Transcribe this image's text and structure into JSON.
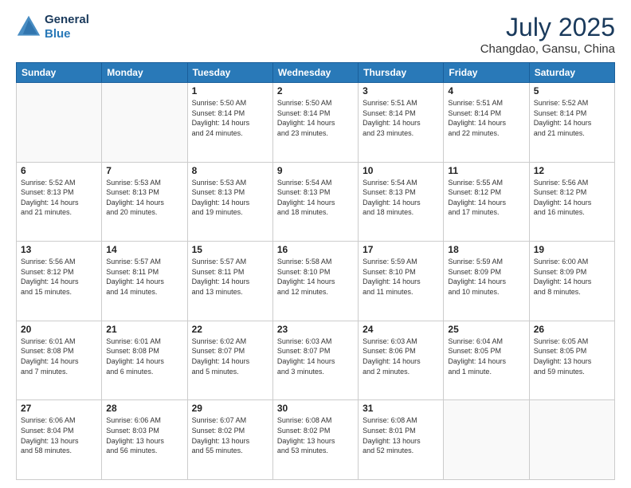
{
  "header": {
    "logo_line1": "General",
    "logo_line2": "Blue",
    "title": "July 2025",
    "subtitle": "Changdao, Gansu, China"
  },
  "weekdays": [
    "Sunday",
    "Monday",
    "Tuesday",
    "Wednesday",
    "Thursday",
    "Friday",
    "Saturday"
  ],
  "weeks": [
    [
      {
        "day": "",
        "info": ""
      },
      {
        "day": "",
        "info": ""
      },
      {
        "day": "1",
        "info": "Sunrise: 5:50 AM\nSunset: 8:14 PM\nDaylight: 14 hours\nand 24 minutes."
      },
      {
        "day": "2",
        "info": "Sunrise: 5:50 AM\nSunset: 8:14 PM\nDaylight: 14 hours\nand 23 minutes."
      },
      {
        "day": "3",
        "info": "Sunrise: 5:51 AM\nSunset: 8:14 PM\nDaylight: 14 hours\nand 23 minutes."
      },
      {
        "day": "4",
        "info": "Sunrise: 5:51 AM\nSunset: 8:14 PM\nDaylight: 14 hours\nand 22 minutes."
      },
      {
        "day": "5",
        "info": "Sunrise: 5:52 AM\nSunset: 8:14 PM\nDaylight: 14 hours\nand 21 minutes."
      }
    ],
    [
      {
        "day": "6",
        "info": "Sunrise: 5:52 AM\nSunset: 8:13 PM\nDaylight: 14 hours\nand 21 minutes."
      },
      {
        "day": "7",
        "info": "Sunrise: 5:53 AM\nSunset: 8:13 PM\nDaylight: 14 hours\nand 20 minutes."
      },
      {
        "day": "8",
        "info": "Sunrise: 5:53 AM\nSunset: 8:13 PM\nDaylight: 14 hours\nand 19 minutes."
      },
      {
        "day": "9",
        "info": "Sunrise: 5:54 AM\nSunset: 8:13 PM\nDaylight: 14 hours\nand 18 minutes."
      },
      {
        "day": "10",
        "info": "Sunrise: 5:54 AM\nSunset: 8:13 PM\nDaylight: 14 hours\nand 18 minutes."
      },
      {
        "day": "11",
        "info": "Sunrise: 5:55 AM\nSunset: 8:12 PM\nDaylight: 14 hours\nand 17 minutes."
      },
      {
        "day": "12",
        "info": "Sunrise: 5:56 AM\nSunset: 8:12 PM\nDaylight: 14 hours\nand 16 minutes."
      }
    ],
    [
      {
        "day": "13",
        "info": "Sunrise: 5:56 AM\nSunset: 8:12 PM\nDaylight: 14 hours\nand 15 minutes."
      },
      {
        "day": "14",
        "info": "Sunrise: 5:57 AM\nSunset: 8:11 PM\nDaylight: 14 hours\nand 14 minutes."
      },
      {
        "day": "15",
        "info": "Sunrise: 5:57 AM\nSunset: 8:11 PM\nDaylight: 14 hours\nand 13 minutes."
      },
      {
        "day": "16",
        "info": "Sunrise: 5:58 AM\nSunset: 8:10 PM\nDaylight: 14 hours\nand 12 minutes."
      },
      {
        "day": "17",
        "info": "Sunrise: 5:59 AM\nSunset: 8:10 PM\nDaylight: 14 hours\nand 11 minutes."
      },
      {
        "day": "18",
        "info": "Sunrise: 5:59 AM\nSunset: 8:09 PM\nDaylight: 14 hours\nand 10 minutes."
      },
      {
        "day": "19",
        "info": "Sunrise: 6:00 AM\nSunset: 8:09 PM\nDaylight: 14 hours\nand 8 minutes."
      }
    ],
    [
      {
        "day": "20",
        "info": "Sunrise: 6:01 AM\nSunset: 8:08 PM\nDaylight: 14 hours\nand 7 minutes."
      },
      {
        "day": "21",
        "info": "Sunrise: 6:01 AM\nSunset: 8:08 PM\nDaylight: 14 hours\nand 6 minutes."
      },
      {
        "day": "22",
        "info": "Sunrise: 6:02 AM\nSunset: 8:07 PM\nDaylight: 14 hours\nand 5 minutes."
      },
      {
        "day": "23",
        "info": "Sunrise: 6:03 AM\nSunset: 8:07 PM\nDaylight: 14 hours\nand 3 minutes."
      },
      {
        "day": "24",
        "info": "Sunrise: 6:03 AM\nSunset: 8:06 PM\nDaylight: 14 hours\nand 2 minutes."
      },
      {
        "day": "25",
        "info": "Sunrise: 6:04 AM\nSunset: 8:05 PM\nDaylight: 14 hours\nand 1 minute."
      },
      {
        "day": "26",
        "info": "Sunrise: 6:05 AM\nSunset: 8:05 PM\nDaylight: 13 hours\nand 59 minutes."
      }
    ],
    [
      {
        "day": "27",
        "info": "Sunrise: 6:06 AM\nSunset: 8:04 PM\nDaylight: 13 hours\nand 58 minutes."
      },
      {
        "day": "28",
        "info": "Sunrise: 6:06 AM\nSunset: 8:03 PM\nDaylight: 13 hours\nand 56 minutes."
      },
      {
        "day": "29",
        "info": "Sunrise: 6:07 AM\nSunset: 8:02 PM\nDaylight: 13 hours\nand 55 minutes."
      },
      {
        "day": "30",
        "info": "Sunrise: 6:08 AM\nSunset: 8:02 PM\nDaylight: 13 hours\nand 53 minutes."
      },
      {
        "day": "31",
        "info": "Sunrise: 6:08 AM\nSunset: 8:01 PM\nDaylight: 13 hours\nand 52 minutes."
      },
      {
        "day": "",
        "info": ""
      },
      {
        "day": "",
        "info": ""
      }
    ]
  ]
}
